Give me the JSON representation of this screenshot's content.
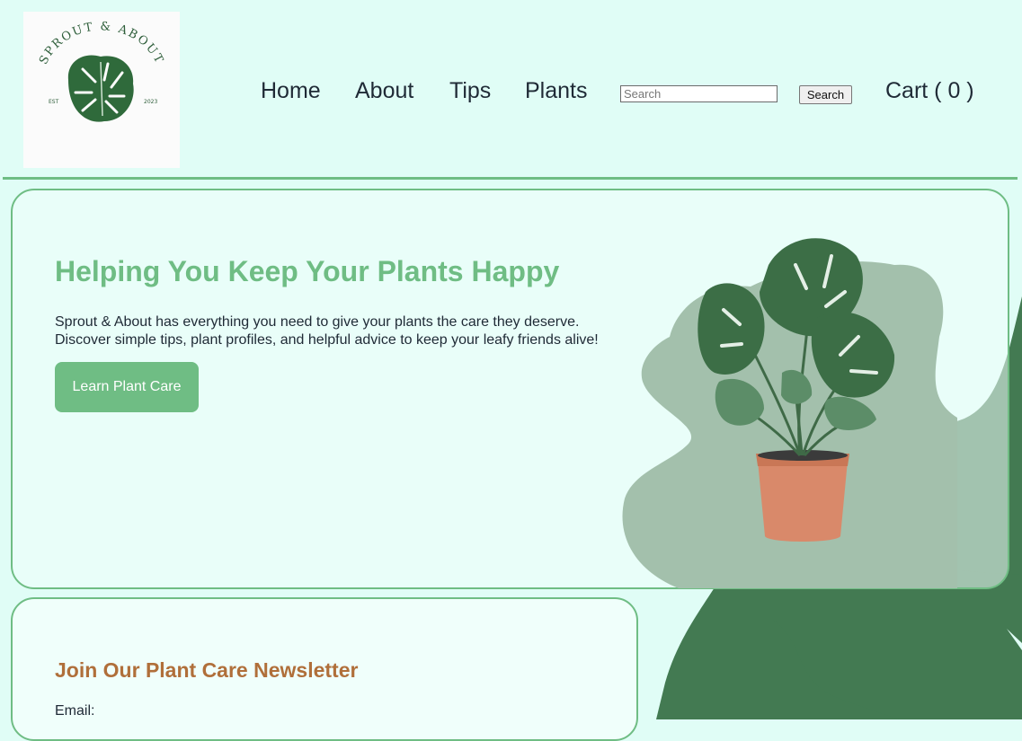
{
  "brand": {
    "logo_text": "SPROUT & ABOUT",
    "logo_left_text": "EST",
    "logo_right_text": "2023"
  },
  "nav": {
    "items": [
      "Home",
      "About",
      "Tips",
      "Plants"
    ]
  },
  "search": {
    "placeholder": "Search",
    "button_label": "Search"
  },
  "cart": {
    "label": "Cart (  0  )",
    "count": 0
  },
  "hero": {
    "title": "Helping You Keep Your Plants Happy",
    "description_line1": "Sprout & About has everything you need to give your plants the care they deserve.",
    "description_line2": "Discover simple tips, plant profiles, and helpful advice to keep your leafy friends alive!",
    "cta_label": "Learn Plant Care"
  },
  "newsletter": {
    "title": "Join Our Plant Care Newsletter",
    "email_label": "Email:"
  },
  "colors": {
    "page_bg": "#e0fdf6",
    "accent_green": "#6fbd84",
    "dark_green": "#437a52",
    "sage": "#a3c0ac",
    "newsletter_title": "#b06f3a",
    "text": "#1f2a36"
  },
  "icons": {
    "logo": "monstera-leaf-icon",
    "hero_image": "potted-monstera-plant"
  }
}
